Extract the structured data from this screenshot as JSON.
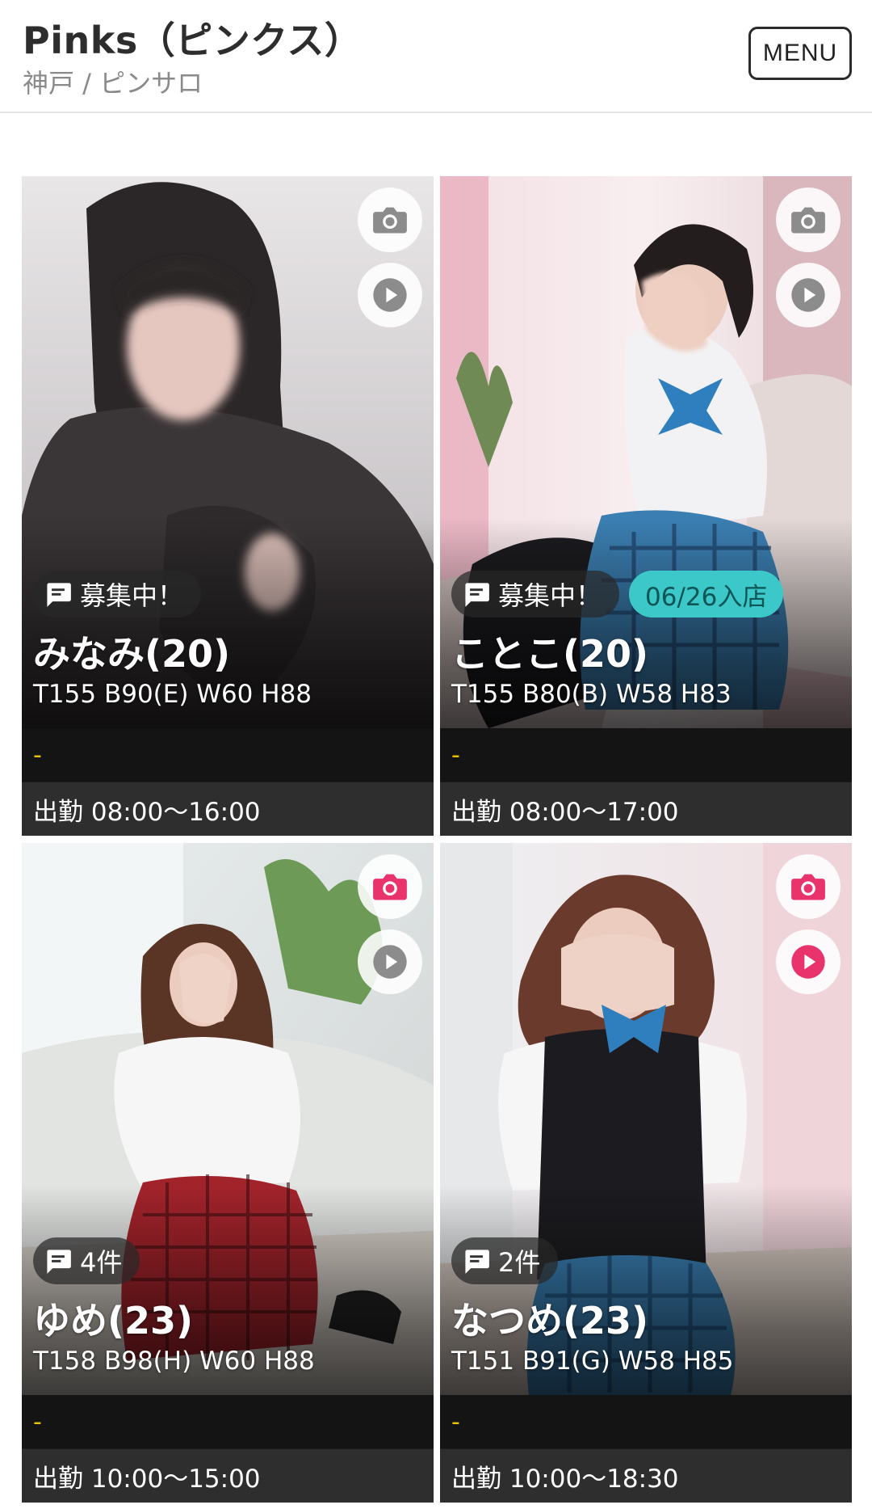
{
  "header": {
    "shop_name": "Pinks（ピンクス）",
    "sub": "神戸 / ピンサロ",
    "menu_label": "MENU"
  },
  "colors": {
    "camera_active": "#e8336c",
    "play_active": "#e8336c",
    "icon_inactive": "#8c8c8c",
    "new_badge": "#3cc8c8",
    "comment_text": "#e8c400"
  },
  "cards": [
    {
      "badge": "募集中！",
      "name": "みなみ(20)",
      "size": "T155 B90(E) W60 H88",
      "comment": "-",
      "shift": "出勤 08:00〜16:00",
      "camera_icon": "camera-icon",
      "play_icon": "play-icon"
    },
    {
      "badge": "募集中！",
      "new_badge": "06/26入店",
      "name": "ことこ(20)",
      "size": "T155 B80(B) W58 H83",
      "comment": "-",
      "shift": "出勤 08:00〜17:00",
      "camera_icon": "camera-icon",
      "play_icon": "play-icon"
    },
    {
      "badge": "4件",
      "name": "ゆめ(23)",
      "size": "T158 B98(H) W60 H88",
      "comment": "-",
      "shift": "出勤 10:00〜15:00",
      "camera_icon": "camera-icon",
      "play_icon": "play-icon"
    },
    {
      "badge": "2件",
      "name": "なつめ(23)",
      "size": "T151 B91(G) W58 H85",
      "comment": "-",
      "shift": "出勤 10:00〜18:30",
      "camera_icon": "camera-icon",
      "play_icon": "play-icon"
    }
  ]
}
